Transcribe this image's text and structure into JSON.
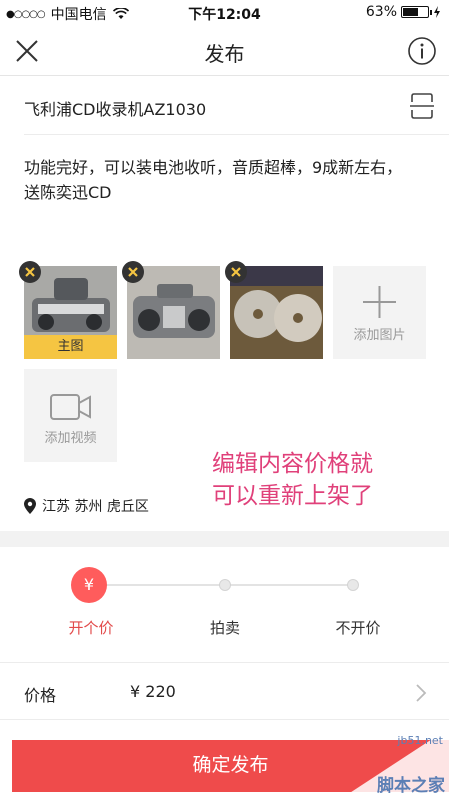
{
  "status_bar": {
    "carrier": "中国电信",
    "time": "下午12:04",
    "battery": "63%",
    "battery_level": 0.63
  },
  "nav": {
    "title": "发布",
    "close_icon": "close-icon",
    "info_icon": "info-icon"
  },
  "product": {
    "title": "飞利浦CD收录机AZ1030",
    "description": "功能完好，可以装电池收听，音质超棒，9成新左右，送陈奕迅CD"
  },
  "media": {
    "main_image_label": "主图",
    "add_photo_label": "添加图片",
    "add_video_label": "添加视频"
  },
  "note": {
    "line1": "编辑内容价格就",
    "line2": "可以重新上架了"
  },
  "location": "江苏 苏州 虎丘区",
  "price_modes": {
    "active_symbol": "¥",
    "options": [
      "开个价",
      "拍卖",
      "不开价"
    ],
    "selected": "开个价"
  },
  "price": {
    "label": "价格",
    "value": "¥ 220"
  },
  "publish_button": "确定发布",
  "watermark": {
    "site": "jb51.net",
    "brand": "脚本之家"
  },
  "colors": {
    "accent_red": "#ef4b4b",
    "main_label_yellow": "#f5c542",
    "note_pink": "#e0407a"
  }
}
